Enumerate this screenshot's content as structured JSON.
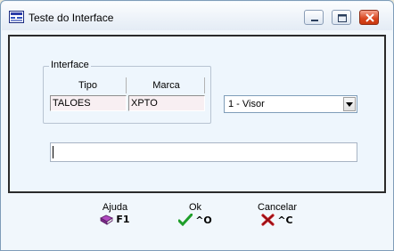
{
  "window": {
    "title": "Teste do Interface",
    "minimize_icon": "minimize-icon",
    "maximize_icon": "maximize-icon",
    "close_icon": "close-icon",
    "app_icon": "app-icon"
  },
  "interface_group": {
    "label": "Interface",
    "columns": [
      {
        "header": "Tipo",
        "value": "TALOES"
      },
      {
        "header": "Marca",
        "value": "XPTO"
      }
    ]
  },
  "device_select": {
    "selected": "1 - Visor"
  },
  "text_input": {
    "value": ""
  },
  "footer": {
    "buttons": [
      {
        "label": "Ajuda",
        "shortcut": "F1",
        "icon": "help-book-icon"
      },
      {
        "label": "Ok",
        "shortcut": "^O",
        "icon": "checkmark-icon"
      },
      {
        "label": "Cancelar",
        "shortcut": "^C",
        "icon": "cancel-x-icon"
      }
    ]
  },
  "colors": {
    "window_bg": "#F1F7FC",
    "client_border": "#2B2B2B",
    "cell_bg": "#F8EFF2",
    "close_button": "#D9451E",
    "check_green": "#1E9E2A",
    "cancel_red": "#C0191F"
  }
}
